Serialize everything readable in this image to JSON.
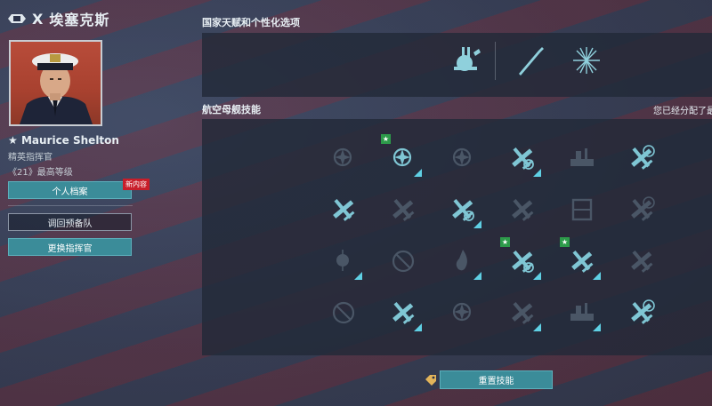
{
  "ship": {
    "tier": "X",
    "name": "埃塞克斯"
  },
  "commander": {
    "name": "Maurice Shelton",
    "rank": "精英指挥官",
    "level_badge": "《21》",
    "level_text": "最高等级"
  },
  "buttons": {
    "profile": "个人档案",
    "new_content": "新内容",
    "return_reserve": "调回预备队",
    "change_commander": "更换指挥官",
    "reset_skills": "重置技能"
  },
  "sections": {
    "national_talents": "国家天赋和个性化选项",
    "carrier_skills": "航空母舰技能",
    "points_note": "您已经分配了最"
  },
  "colors": {
    "accent": "#3b8c99",
    "active_icon": "#7fc6d4",
    "inactive_icon": "#4a5666",
    "star": "#2d9b4a",
    "badge": "#c81e2a"
  },
  "skills": [
    {
      "row": 1,
      "col": 1,
      "icon": "aircraft-engine-icon",
      "active": false,
      "corner": false,
      "star": false
    },
    {
      "row": 1,
      "col": 2,
      "icon": "engine-boost-icon",
      "active": true,
      "corner": true,
      "star": true
    },
    {
      "row": 1,
      "col": 3,
      "icon": "engine-cooldown-icon",
      "active": false,
      "corner": false,
      "star": false
    },
    {
      "row": 1,
      "col": 4,
      "icon": "aircraft-repair-icon",
      "active": true,
      "corner": true,
      "star": false
    },
    {
      "row": 1,
      "col": 5,
      "icon": "hangar-icon",
      "active": false,
      "corner": false,
      "star": false
    },
    {
      "row": 1,
      "col": 6,
      "icon": "aircraft-target-icon",
      "active": true,
      "corner": false,
      "star": false
    },
    {
      "row": 2,
      "col": 1,
      "icon": "torpedo-bomber-icon",
      "active": true,
      "corner": false,
      "star": false
    },
    {
      "row": 2,
      "col": 2,
      "icon": "aa-icon",
      "active": false,
      "corner": false,
      "star": false
    },
    {
      "row": 2,
      "col": 3,
      "icon": "aircraft-speed-icon",
      "active": true,
      "corner": true,
      "star": false
    },
    {
      "row": 2,
      "col": 4,
      "icon": "squadron-icon",
      "active": false,
      "corner": false,
      "star": false
    },
    {
      "row": 2,
      "col": 5,
      "icon": "armor-icon",
      "active": false,
      "corner": false,
      "star": false
    },
    {
      "row": 2,
      "col": 6,
      "icon": "aircraft-crosshair-icon",
      "active": false,
      "corner": false,
      "star": false
    },
    {
      "row": 3,
      "col": 1,
      "icon": "detection-icon",
      "active": false,
      "corner": true,
      "star": false
    },
    {
      "row": 3,
      "col": 2,
      "icon": "no-entry-icon",
      "active": false,
      "corner": false,
      "star": false
    },
    {
      "row": 3,
      "col": 3,
      "icon": "fire-icon",
      "active": false,
      "corner": true,
      "star": false
    },
    {
      "row": 3,
      "col": 4,
      "icon": "squadron-repair-icon",
      "active": true,
      "corner": true,
      "star": true
    },
    {
      "row": 3,
      "col": 5,
      "icon": "squadron-armor-icon",
      "active": true,
      "corner": true,
      "star": true
    },
    {
      "row": 3,
      "col": 6,
      "icon": "squadron-formation-icon",
      "active": false,
      "corner": false,
      "star": false
    },
    {
      "row": 4,
      "col": 1,
      "icon": "no-entry-icon",
      "active": false,
      "corner": false,
      "star": false
    },
    {
      "row": 4,
      "col": 2,
      "icon": "fighter-icon",
      "active": true,
      "corner": true,
      "star": false
    },
    {
      "row": 4,
      "col": 3,
      "icon": "bombs-icon",
      "active": false,
      "corner": false,
      "star": false
    },
    {
      "row": 4,
      "col": 4,
      "icon": "rocket-icon",
      "active": false,
      "corner": true,
      "star": false
    },
    {
      "row": 4,
      "col": 5,
      "icon": "ship-deck-icon",
      "active": false,
      "corner": true,
      "star": false
    },
    {
      "row": 4,
      "col": 6,
      "icon": "aircraft-sight-icon",
      "active": true,
      "corner": false,
      "star": false
    }
  ]
}
